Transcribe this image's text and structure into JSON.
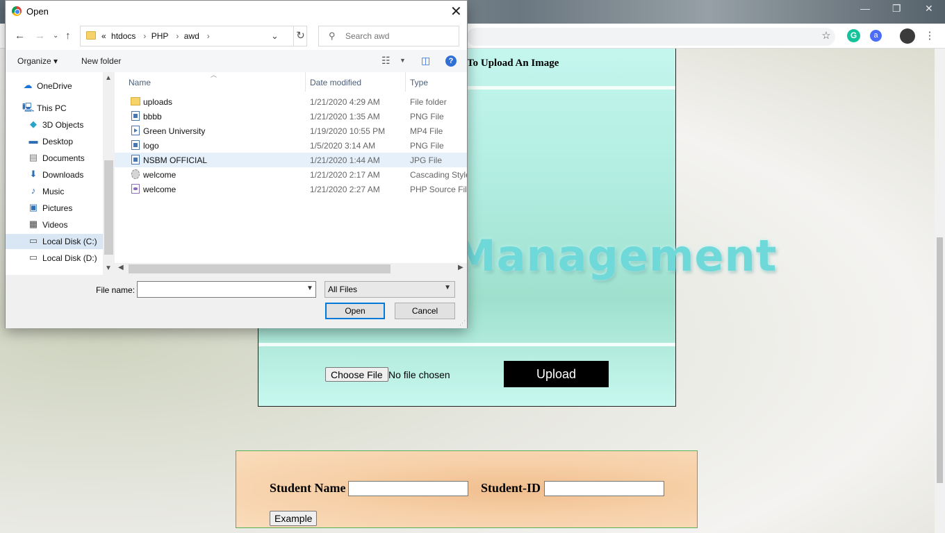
{
  "browser": {
    "extensions": [
      "grammarly-icon",
      "account-icon"
    ],
    "window_controls": [
      "minimize-icon",
      "restore-icon",
      "close-icon"
    ]
  },
  "page": {
    "upload_panel": {
      "title": "To Upload An Image",
      "hero_text": "Management",
      "choose_file_label": "Choose File",
      "no_file_text": "No file chosen",
      "upload_label": "Upload"
    },
    "student_panel": {
      "name_label": "Student Name",
      "id_label": "Student-ID",
      "example_label": "Example"
    }
  },
  "dialog": {
    "title": "Open",
    "breadcrumb": {
      "prefix": "«",
      "items": [
        "htdocs",
        "PHP",
        "awd"
      ]
    },
    "search_placeholder": "Search awd",
    "organize_label": "Organize ▾",
    "new_folder_label": "New folder",
    "nav_items": [
      {
        "label": "OneDrive",
        "icon": "cloud-icon"
      },
      {
        "label": "This PC",
        "icon": "computer-icon"
      },
      {
        "label": "3D Objects",
        "icon": "cube-icon"
      },
      {
        "label": "Desktop",
        "icon": "desktop-icon"
      },
      {
        "label": "Documents",
        "icon": "documents-icon"
      },
      {
        "label": "Downloads",
        "icon": "download-icon"
      },
      {
        "label": "Music",
        "icon": "music-icon"
      },
      {
        "label": "Pictures",
        "icon": "pictures-icon"
      },
      {
        "label": "Videos",
        "icon": "videos-icon"
      },
      {
        "label": "Local Disk (C:)",
        "icon": "drive-icon",
        "selected": true
      },
      {
        "label": "Local Disk (D:)",
        "icon": "drive-icon"
      }
    ],
    "columns": [
      "Name",
      "Date modified",
      "Type"
    ],
    "files": [
      {
        "name": "uploads",
        "date": "1/21/2020 4:29 AM",
        "type": "File folder",
        "icon": "folder"
      },
      {
        "name": "bbbb",
        "date": "1/21/2020 1:35 AM",
        "type": "PNG File",
        "icon": "img"
      },
      {
        "name": "Green University",
        "date": "1/19/2020 10:55 PM",
        "type": "MP4 File",
        "icon": "vid"
      },
      {
        "name": "logo",
        "date": "1/5/2020 3:14 AM",
        "type": "PNG File",
        "icon": "img"
      },
      {
        "name": "NSBM OFFICIAL",
        "date": "1/21/2020 1:44 AM",
        "type": "JPG File",
        "icon": "img",
        "selected": true
      },
      {
        "name": "welcome",
        "date": "1/21/2020 2:17 AM",
        "type": "Cascading Style",
        "icon": "css"
      },
      {
        "name": "welcome",
        "date": "1/21/2020 2:27 AM",
        "type": "PHP Source File",
        "icon": "php"
      }
    ],
    "file_name_label": "File name:",
    "file_name_value": "",
    "file_type": "All Files",
    "open_label": "Open",
    "cancel_label": "Cancel"
  }
}
